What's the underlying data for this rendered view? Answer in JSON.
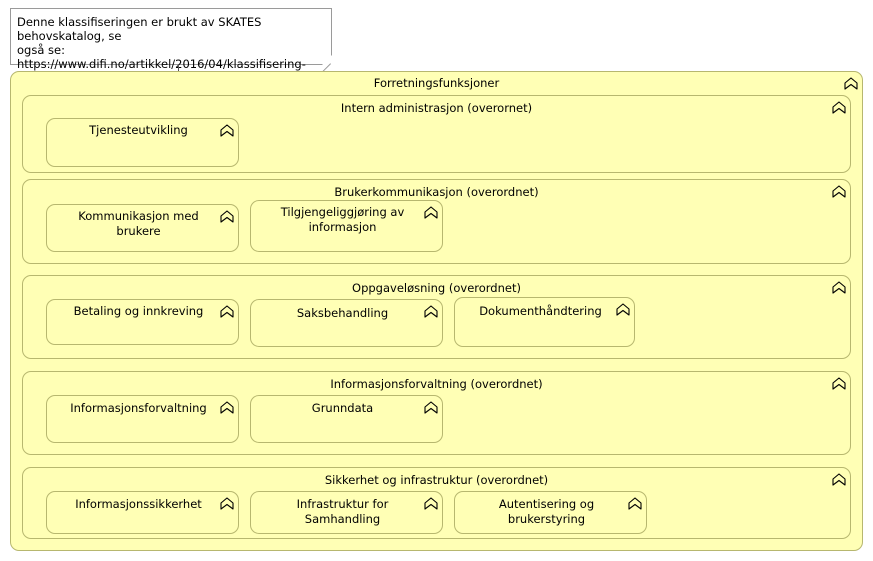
{
  "note": {
    "text": "Denne klassifiseringen er brukt av SKATES behovskatalog, se\nogså se: https://www.difi.no/artikkel/2016/04/klassifisering-\nav-it-losninger"
  },
  "root": {
    "title": "Forretningsfunksjoner"
  },
  "groups": [
    {
      "title": "Intern administrasjon (overornet)",
      "items": [
        {
          "label": "Tjenesteutvikling"
        }
      ]
    },
    {
      "title": "Brukerkommunikasjon (overordnet)",
      "items": [
        {
          "label": "Kommunikasjon med brukere"
        },
        {
          "label": "Tilgjengeliggjøring av informasjon"
        }
      ]
    },
    {
      "title": "Oppgaveløsning (overordnet)",
      "items": [
        {
          "label": "Betaling og innkreving"
        },
        {
          "label": "Saksbehandling"
        },
        {
          "label": "Dokumenthåndtering"
        }
      ]
    },
    {
      "title": "Informasjonsforvaltning (overordnet)",
      "items": [
        {
          "label": "Informasjonsforvaltning"
        },
        {
          "label": "Grunndata"
        }
      ]
    },
    {
      "title": "Sikkerhet og infrastruktur (overordnet)",
      "items": [
        {
          "label": "Informasjonssikkerhet"
        },
        {
          "label": "Infrastruktur for Samhandling"
        },
        {
          "label": "Autentisering og brukerstyring"
        }
      ]
    }
  ],
  "icons": {
    "business_function": "business-function-icon"
  },
  "colors": {
    "fill": "#ffffb5",
    "border": "#b7b76f"
  }
}
